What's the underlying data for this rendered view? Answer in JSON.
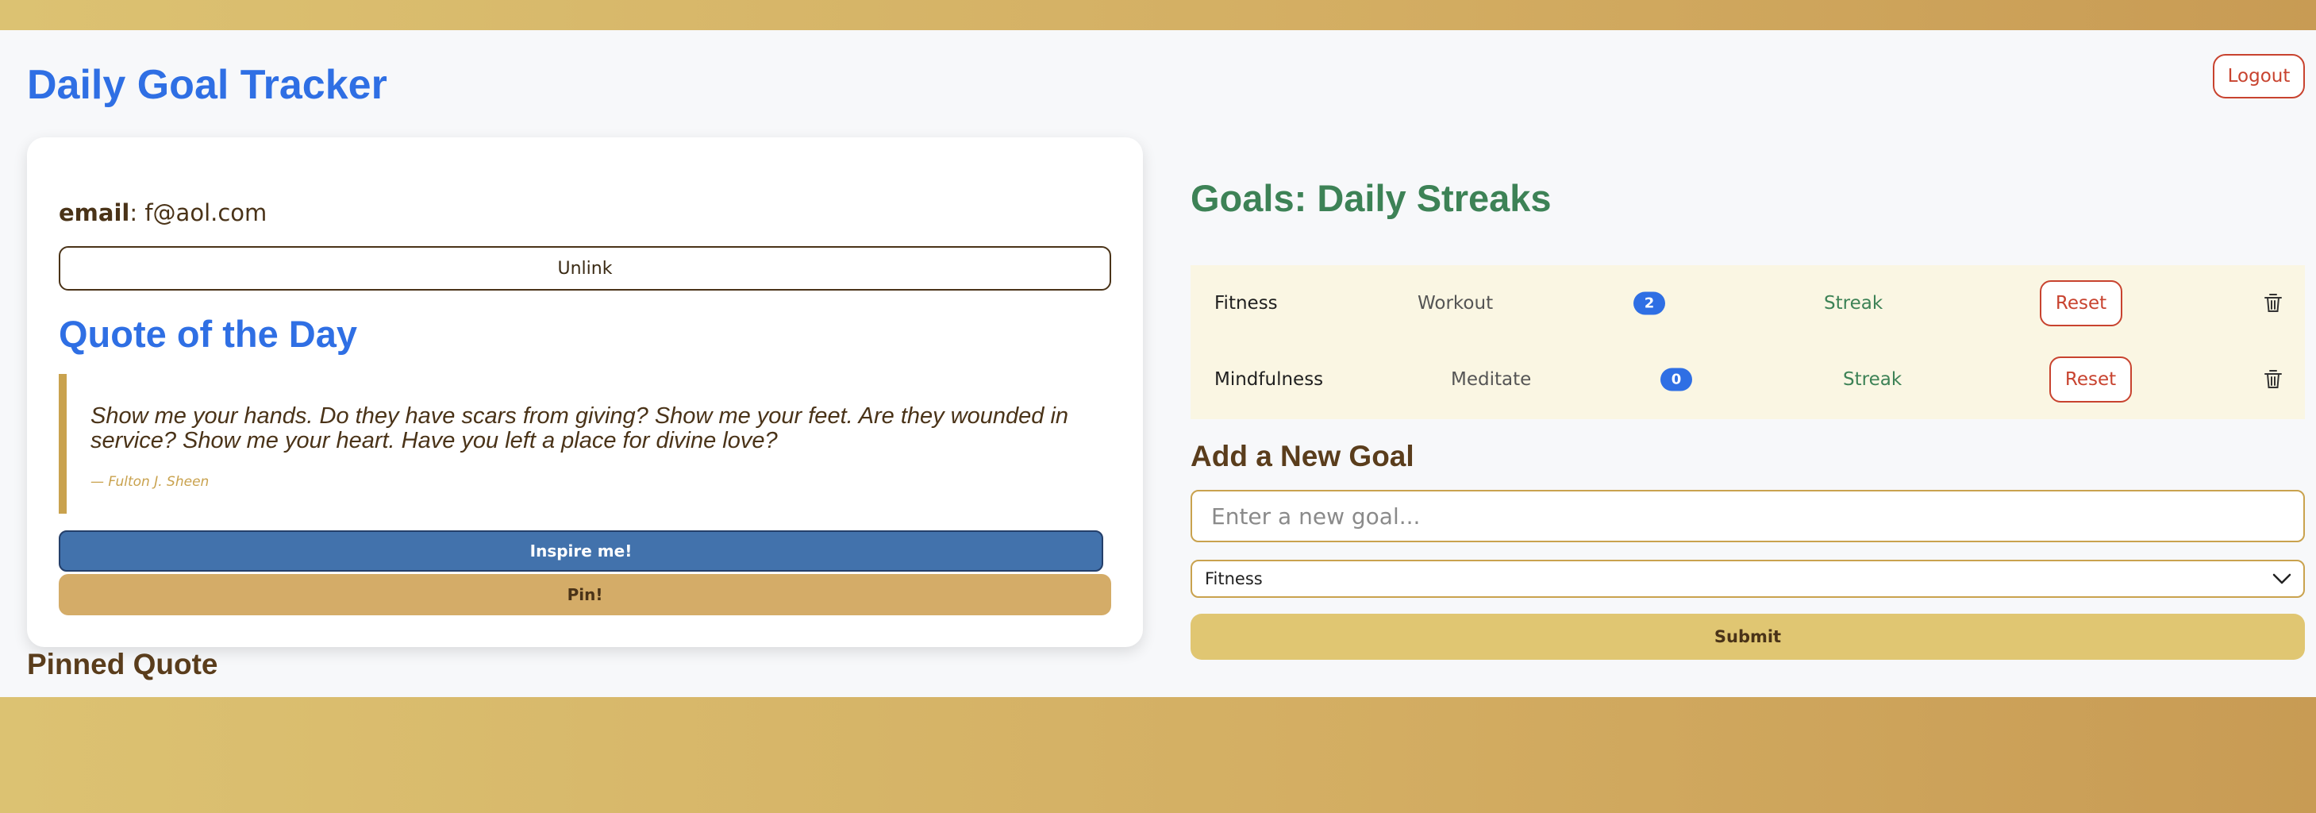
{
  "header": {
    "title": "Daily Goal Tracker",
    "logout_label": "Logout"
  },
  "account": {
    "email_label": "email",
    "email_value": "f@aol.com",
    "unlink_label": "Unlink"
  },
  "quote_section": {
    "title": "Quote of the Day",
    "text": "Show me your hands. Do they have scars from giving? Show me your feet. Are they wounded in service? Show me your heart. Have you left a place for divine love?",
    "author": "— Fulton J. Sheen",
    "inspire_label": "Inspire me!",
    "pin_label": "Pin!"
  },
  "pinned": {
    "title": "Pinned Quote"
  },
  "goals": {
    "title": "Goals: Daily Streaks",
    "items": [
      {
        "category": "Fitness",
        "name": "Workout",
        "count": "2",
        "streak_label": "Streak",
        "reset_label": "Reset",
        "delete_icon": "trash-icon"
      },
      {
        "category": "Mindfulness",
        "name": "Meditate",
        "count": "0",
        "streak_label": "Streak",
        "reset_label": "Reset",
        "delete_icon": "trash-icon"
      }
    ]
  },
  "add_goal": {
    "title": "Add a New Goal",
    "input_placeholder": "Enter a new goal...",
    "input_value": "",
    "category_selected": "Fitness",
    "dropdown_icon": "chevron-down-icon",
    "submit_label": "Submit"
  },
  "colors": {
    "primary_blue": "#2f6fe4",
    "goal_green": "#3d8256",
    "danger_red": "#c8432f",
    "gold": "#c9a24e",
    "brown_text": "#4a3318"
  }
}
